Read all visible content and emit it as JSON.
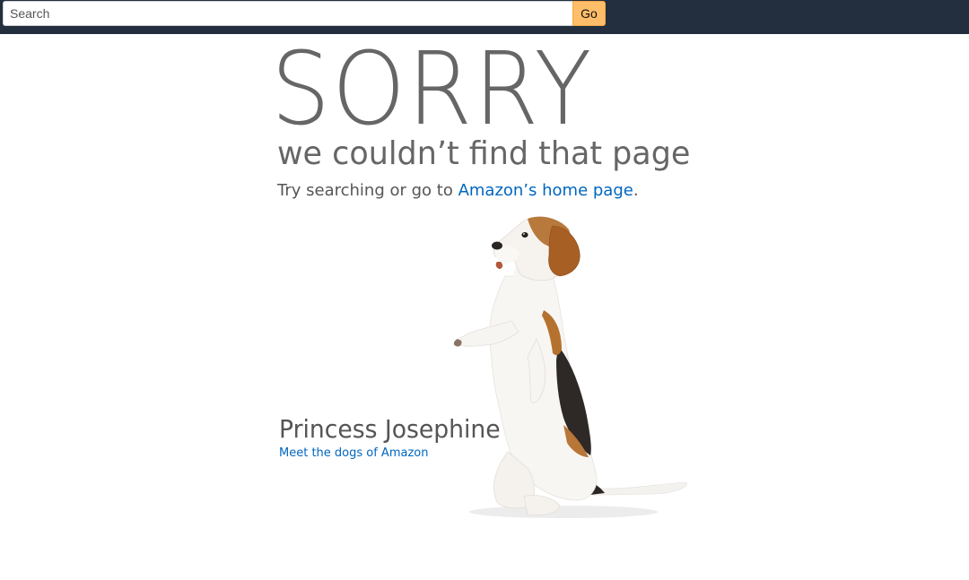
{
  "header": {
    "search": {
      "placeholder": "Search",
      "value": ""
    },
    "go_label": "Go"
  },
  "main": {
    "title": "SORRY",
    "subtitle": "we couldn’t find that page",
    "try_text": "Try searching or go to ",
    "home_link": "Amazon’s home page",
    "try_end": ".",
    "dog": {
      "name": "Princess Josephine",
      "link": "Meet the dogs of Amazon",
      "image": "beagle-dog-photo"
    }
  },
  "colors": {
    "topbar": "#232f3e",
    "go_button": "#febd69",
    "link": "#0066c0",
    "text": "#666666"
  }
}
